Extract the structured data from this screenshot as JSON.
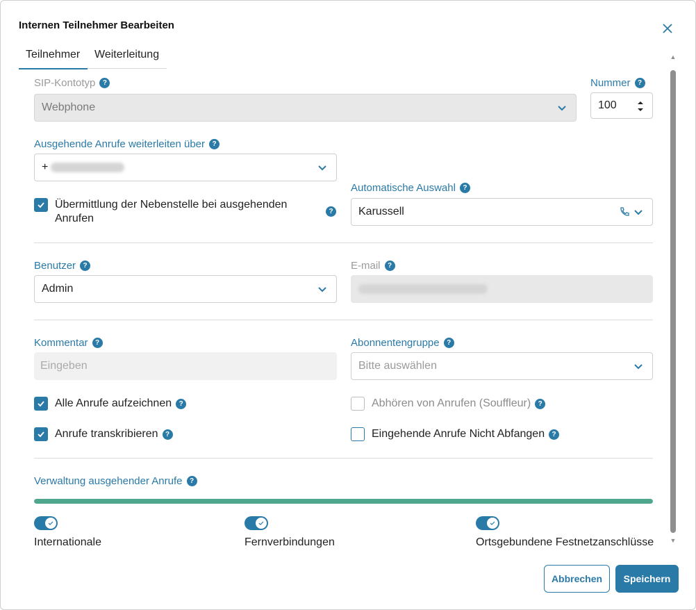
{
  "dialog": {
    "title": "Internen Teilnehmer Bearbeiten",
    "tabs": [
      {
        "label": "Teilnehmer",
        "active": true
      },
      {
        "label": "Weiterleitung",
        "active": false
      }
    ]
  },
  "form": {
    "sip_type": {
      "label": "SIP-Kontotyp",
      "value": "Webphone"
    },
    "number": {
      "label": "Nummer",
      "value": "100"
    },
    "outgoing_route": {
      "label": "Ausgehende Anrufe weiterleiten über",
      "value_prefix": "+"
    },
    "extension_transmit": {
      "label": "Übermittlung der Nebenstelle bei ausgehenden Anrufen",
      "checked": true
    },
    "auto_select": {
      "label": "Automatische Auswahl",
      "value": "Karussell"
    },
    "user": {
      "label": "Benutzer",
      "value": "Admin"
    },
    "email": {
      "label": "E-mail"
    },
    "comment": {
      "label": "Kommentar",
      "placeholder": "Eingeben"
    },
    "subscriber_group": {
      "label": "Abonnentengruppe",
      "placeholder": "Bitte auswählen"
    },
    "record_all": {
      "label": "Alle Anrufe aufzeichnen",
      "checked": true
    },
    "transcribe": {
      "label": "Anrufe transkribieren",
      "checked": true
    },
    "listen_calls": {
      "label": "Abhören von Anrufen (Souffleur)",
      "checked": false
    },
    "no_intercept": {
      "label": "Eingehende Anrufe Nicht Abfangen",
      "checked": false
    }
  },
  "outgoing_management": {
    "label": "Verwaltung ausgehender Anrufe",
    "progress": 1.0,
    "toggles": [
      {
        "label": "Internationale",
        "on": true
      },
      {
        "label": "Fernverbindungen",
        "on": true
      },
      {
        "label": "Ortsgebundene Festnetzanschlüsse",
        "on": true
      }
    ]
  },
  "actions": {
    "cancel": "Abbrechen",
    "save": "Speichern"
  },
  "icons": {
    "help": "?",
    "close": "close-icon",
    "chevron": "chevron-down-icon",
    "phone": "phone-icon",
    "check": "check-icon"
  },
  "colors": {
    "accent": "#2a7aa8",
    "progress": "#4ea68c"
  }
}
